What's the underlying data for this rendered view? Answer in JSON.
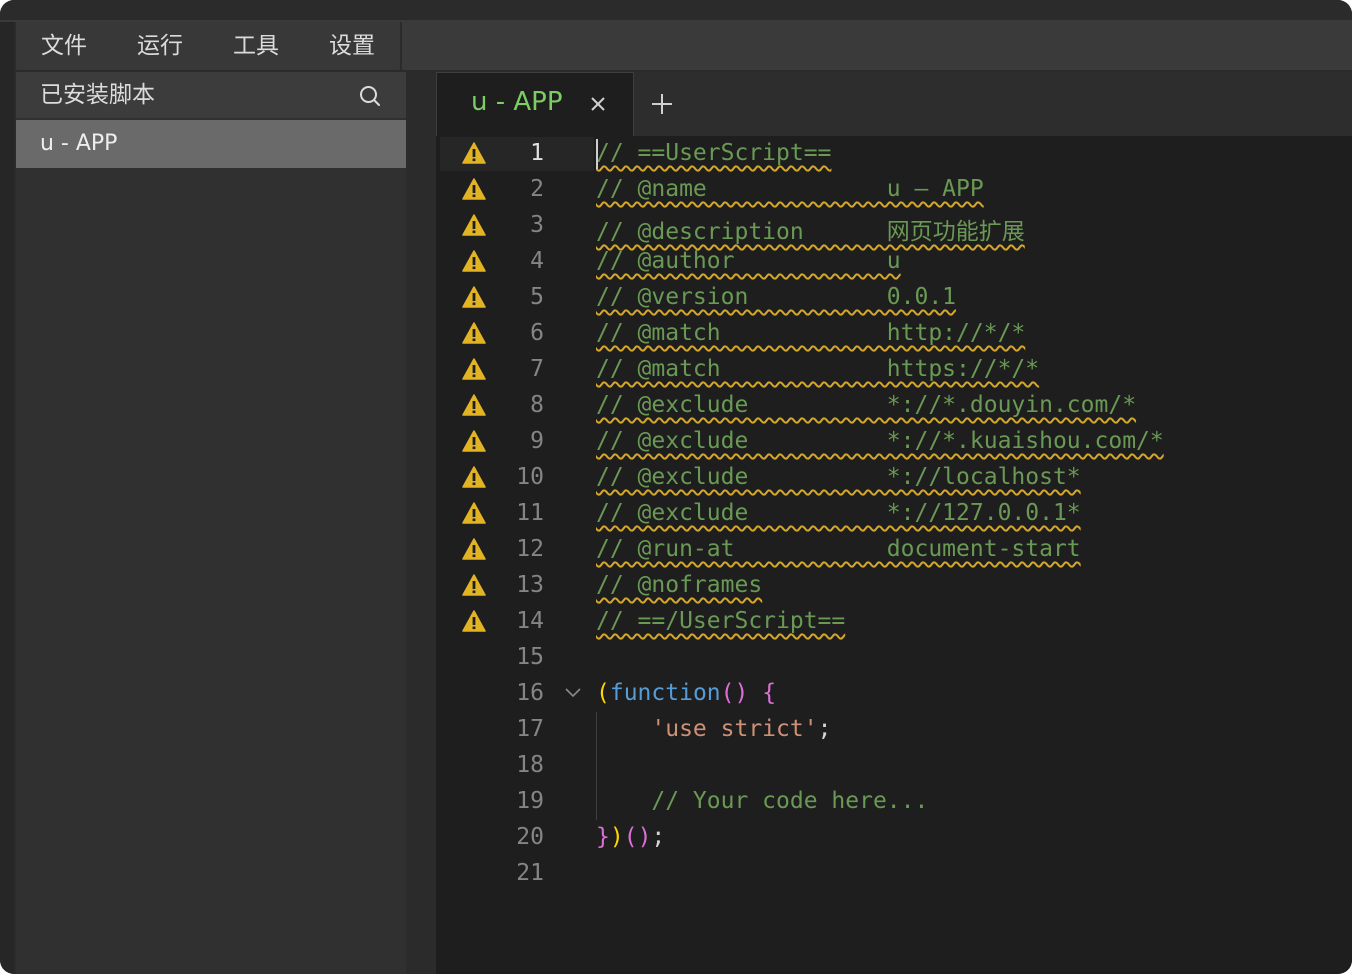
{
  "menu": {
    "items": [
      "文件",
      "运行",
      "工具",
      "设置"
    ]
  },
  "sidebar": {
    "title": "已安装脚本",
    "search_icon": "search-icon",
    "scripts": [
      "u - APP"
    ]
  },
  "editor": {
    "tab": {
      "label": "u - APP",
      "close_icon": "close-icon"
    },
    "add_tab_icon": "plus-icon",
    "active_line": 1,
    "lines": [
      {
        "n": "1",
        "text": "// ==UserScript==",
        "warn": true
      },
      {
        "n": "2",
        "text": "// @name             u – APP",
        "warn": true
      },
      {
        "n": "3",
        "text": "// @description      网页功能扩展",
        "warn": true
      },
      {
        "n": "4",
        "text": "// @author           u",
        "warn": true
      },
      {
        "n": "5",
        "text": "// @version          0.0.1",
        "warn": true
      },
      {
        "n": "6",
        "text": "// @match            http://*/*",
        "warn": true
      },
      {
        "n": "7",
        "text": "// @match            https://*/*",
        "warn": true
      },
      {
        "n": "8",
        "text": "// @exclude          *://*.douyin.com/*",
        "warn": true
      },
      {
        "n": "9",
        "text": "// @exclude          *://*.kuaishou.com/*",
        "warn": true
      },
      {
        "n": "10",
        "text": "// @exclude          *://localhost*",
        "warn": true
      },
      {
        "n": "11",
        "text": "// @exclude          *://127.0.0.1*",
        "warn": true
      },
      {
        "n": "12",
        "text": "// @run-at           document-start",
        "warn": true
      },
      {
        "n": "13",
        "text": "// @noframes",
        "warn": true
      },
      {
        "n": "14",
        "text": "// ==/UserScript==",
        "warn": true
      },
      {
        "n": "15",
        "text": "",
        "warn": false
      },
      {
        "n": "16",
        "tokens": [
          [
            "paren",
            "("
          ],
          [
            "kw",
            "function"
          ],
          [
            "paren2",
            "()"
          ],
          [
            "plain",
            " "
          ],
          [
            "paren2",
            "{"
          ]
        ],
        "warn": false,
        "fold": true
      },
      {
        "n": "17",
        "tokens": [
          [
            "plain",
            "    "
          ],
          [
            "str",
            "'use strict'"
          ],
          [
            "plain",
            ";"
          ]
        ],
        "warn": false
      },
      {
        "n": "18",
        "text": "",
        "warn": false
      },
      {
        "n": "19",
        "tokens": [
          [
            "plain",
            "    "
          ],
          [
            "cmt",
            "// Your code here..."
          ]
        ],
        "warn": false
      },
      {
        "n": "20",
        "tokens": [
          [
            "paren2",
            "}"
          ],
          [
            "paren",
            ")"
          ],
          [
            "paren2",
            "()"
          ],
          [
            "plain",
            ";"
          ]
        ],
        "warn": false
      },
      {
        "n": "21",
        "text": "",
        "warn": false
      }
    ]
  },
  "colors": {
    "comment": "#6a9955",
    "keyword": "#569cd6",
    "string": "#ce9178",
    "tab_label": "#7ccd62",
    "warning": "#e2b423",
    "squiggle": "#d4a72c"
  }
}
